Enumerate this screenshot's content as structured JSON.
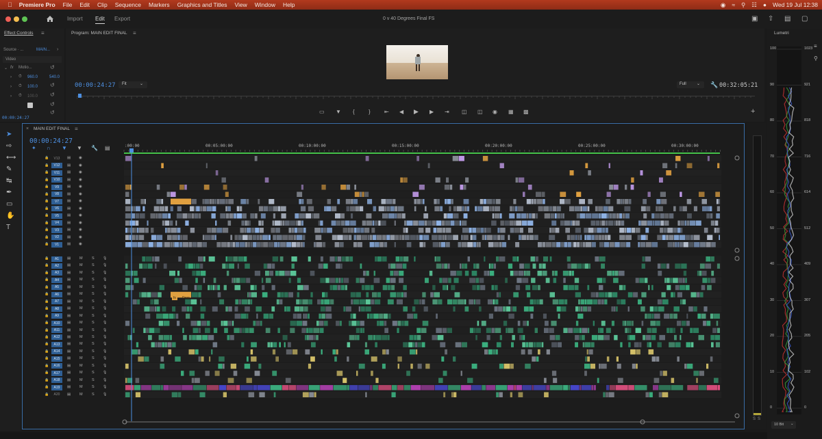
{
  "menubar": {
    "items": [
      "Premiere Pro",
      "File",
      "Edit",
      "Clip",
      "Sequence",
      "Markers",
      "Graphics and Titles",
      "View",
      "Window",
      "Help"
    ],
    "clock": "Wed 19 Jul  12:38"
  },
  "header": {
    "tabs": [
      "Import",
      "Edit",
      "Export"
    ],
    "active_tab": "Edit",
    "project_title": "0 v 40 Degrees Final FS"
  },
  "effect_controls": {
    "title": "Effect Controls",
    "source_label": "Source · ...",
    "seq_label": "MAIN...",
    "video_label": "Video",
    "fx_label": "fx",
    "motion_label": "Motio...",
    "values": [
      "960.0",
      "540.0",
      "100.0",
      "100.0"
    ],
    "timecode": "00:00:24:27"
  },
  "program": {
    "title": "Program: MAIN EDIT FINAL",
    "timecode": "00:00:24:27",
    "fit": "Fit",
    "quality": "Full",
    "duration": "00:32:05:21"
  },
  "timeline": {
    "title": "MAIN EDIT FINAL",
    "timecode": "00:00:24:27",
    "ruler": [
      ":00:00",
      "00:05:00:00",
      "00:10:00:00",
      "00:15:00:00",
      "00:20:00:00",
      "00:25:00:00",
      "00:30:00:00"
    ],
    "video_tracks": [
      "V13",
      "V12",
      "V11",
      "V10",
      "V9",
      "V8",
      "V7",
      "V6",
      "V5",
      "V4",
      "V3",
      "V2",
      "V1"
    ],
    "audio_tracks": [
      "A1",
      "A2",
      "A3",
      "A4",
      "A5",
      "A6",
      "A7",
      "A8",
      "A9",
      "A10",
      "A11",
      "A12",
      "A13",
      "A14",
      "A15",
      "A16",
      "A17",
      "A18",
      "A19",
      "A20"
    ],
    "mute_label": "M",
    "solo_label": "S",
    "clip_labels": [
      "fx",
      "Drop"
    ]
  },
  "meters": {
    "solo_labels": [
      "S",
      "S"
    ]
  },
  "lumetri": {
    "title": "Lumetri",
    "scale_left": [
      "100",
      "90",
      "80",
      "70",
      "60",
      "50",
      "40",
      "30",
      "20",
      "10",
      "0"
    ],
    "scale_right": [
      "1023",
      "921",
      "818",
      "716",
      "614",
      "512",
      "409",
      "307",
      "205",
      "102",
      "0"
    ],
    "bit_depth": "10 Bit"
  },
  "colors": {
    "menubar": "#a8361b",
    "accent": "#4d8fe0",
    "track_video": "#2f5f94",
    "audio_green": "#3bb07f",
    "clip_purple": "#b040b0",
    "clip_blue": "#4a4ad8",
    "clip_orange": "#e0a040",
    "clip_lilac": "#c09ae8",
    "clip_grey": "#8a8f99"
  }
}
